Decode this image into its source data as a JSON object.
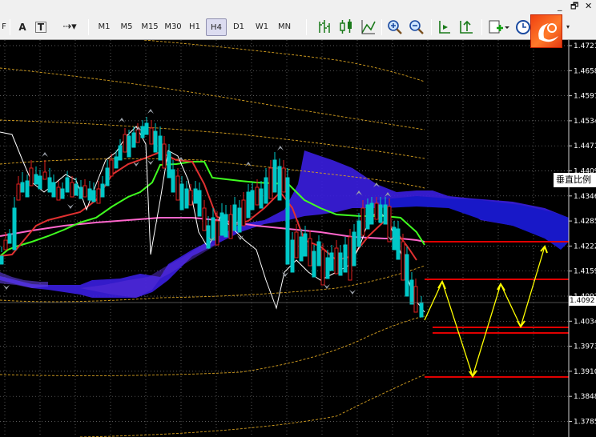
{
  "window": {
    "minimize_glyph": "_",
    "restore_glyph": "🗗"
  },
  "toolbar": {
    "edge_glyph": "F",
    "text_tool": "A",
    "label_tool": "T",
    "timeframes": [
      "M1",
      "M5",
      "M15",
      "M30",
      "H1",
      "H4",
      "D1",
      "W1",
      "MN"
    ],
    "active_timeframe": "H4"
  },
  "price_axis": {
    "labels": [
      "1.4721",
      "1.4658",
      "1.4597",
      "1.4534",
      "1.4471",
      "1.4409",
      "1.4346",
      "1.4285",
      "1.4222",
      "1.4159",
      "1.4092",
      "1.4034",
      "1.3973",
      "1.3910",
      "1.3848",
      "1.3785"
    ],
    "current_price": "1.4092"
  },
  "scale_label": "垂直比例",
  "colors": {
    "background": "#000000",
    "grid": "#7a7a7a",
    "bull_candle": "#00c8c8",
    "bear_candle": "#e02020",
    "cloud": "#3a1ee0",
    "cloud_dark": "#1818b8",
    "forecast": "#ffff00",
    "level": "#e00000",
    "kijun": "#40ff20",
    "tenkan": "#e03030",
    "ma": "#ff66cc",
    "chikou": "#ffffff",
    "band": "#d6a020"
  }
}
